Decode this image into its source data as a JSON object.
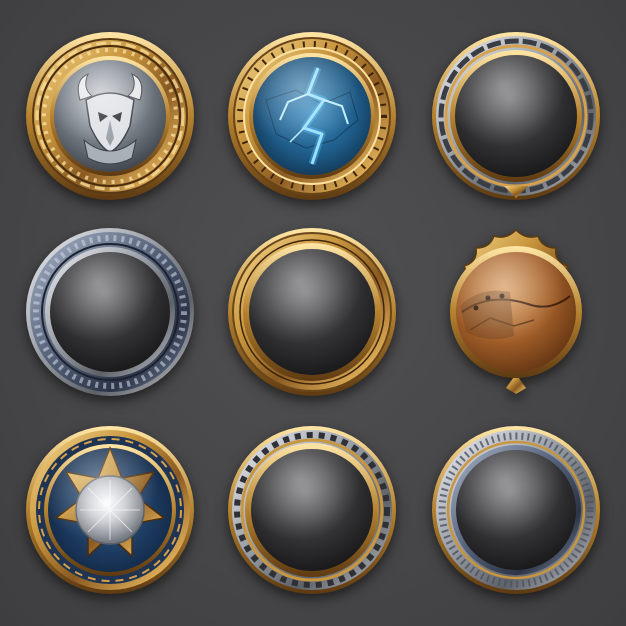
{
  "sheet": {
    "background": "#48484a"
  },
  "buttons": [
    {
      "slot": 1,
      "frame": "gold-celtic",
      "center": "silver-horned-helmet-emblem"
    },
    {
      "slot": 2,
      "frame": "gold-bronze-tribal",
      "center": "blue-lightning-crystal"
    },
    {
      "slot": 3,
      "frame": "silver-gold-filigree",
      "center": "blank-dark-gem"
    },
    {
      "slot": 4,
      "frame": "steel-blue-feathered",
      "center": "blank-dark-gem"
    },
    {
      "slot": 5,
      "frame": "plain-bronze",
      "center": "blank-dark-gem"
    },
    {
      "slot": 6,
      "frame": "ornate-gold-scrolled",
      "center": "cracked-leather-patch"
    },
    {
      "slot": 7,
      "frame": "gold-blue-rune",
      "center": "silver-star-medallion"
    },
    {
      "slot": 8,
      "frame": "gold-silver-zigzag",
      "center": "blank-dark-gem"
    },
    {
      "slot": 9,
      "frame": "silver-gold-etched",
      "center": "blank-dark-gem"
    }
  ],
  "colors": {
    "gold": "#c8963e",
    "gold_light": "#f2d188",
    "bronze": "#8a5a22",
    "silver": "#b9bcc2",
    "steel": "#5f6b80",
    "gem_dark": "#2c2c2e",
    "lightning_blue": "#4fc3ff",
    "leather": "#a8622a"
  }
}
